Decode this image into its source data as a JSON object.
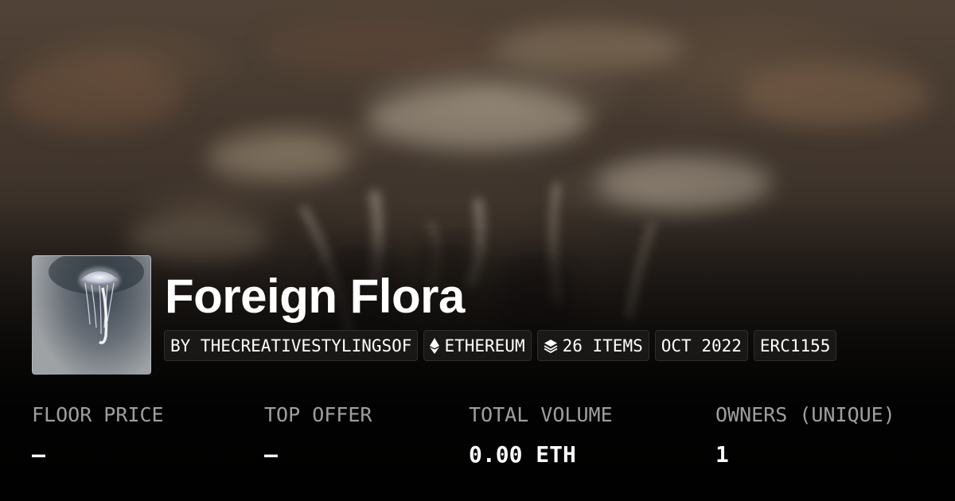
{
  "collection": {
    "title": "Foreign Flora",
    "creator": "BY THECREATIVESTYLINGSOF",
    "chain": {
      "label": "ETHEREUM",
      "icon": "ethereum-icon"
    },
    "items": {
      "label": "26 ITEMS",
      "icon": "layers-icon"
    },
    "date": "OCT 2022",
    "standard": "ERC1155"
  },
  "stats": [
    {
      "label": "FLOOR PRICE",
      "value": "—"
    },
    {
      "label": "TOP OFFER",
      "value": "—"
    },
    {
      "label": "TOTAL VOLUME",
      "value": "0.00 ETH"
    },
    {
      "label": "OWNERS (UNIQUE)",
      "value": "1"
    }
  ],
  "colors": {
    "text": "#ffffff",
    "muted_label": "#bdbab7",
    "tag_bg": "#1e1c1a"
  }
}
